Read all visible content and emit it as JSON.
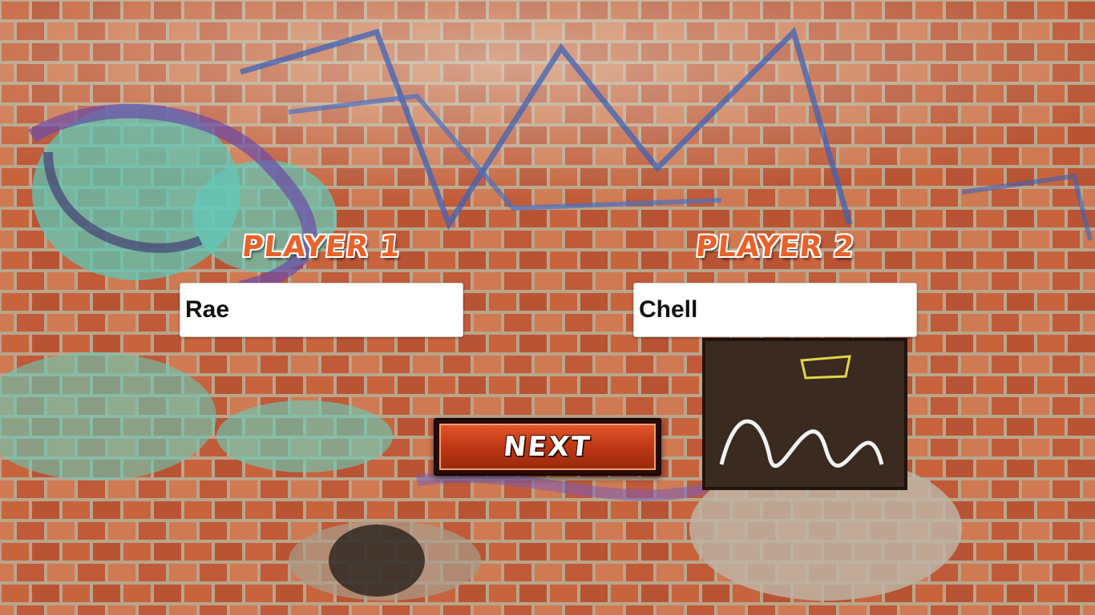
{
  "player1": {
    "label": "PLAYER 1",
    "name_value": "Rae"
  },
  "player2": {
    "label": "PLAYER 2",
    "name_value": "Chell"
  },
  "next_button": {
    "label": "NEXT"
  },
  "colors": {
    "label_orange": "#e8622a",
    "button_red": "#c23a16",
    "button_border_dark": "#2a0a04"
  },
  "background": {
    "description_icon": "graffiti-brick-wall"
  }
}
